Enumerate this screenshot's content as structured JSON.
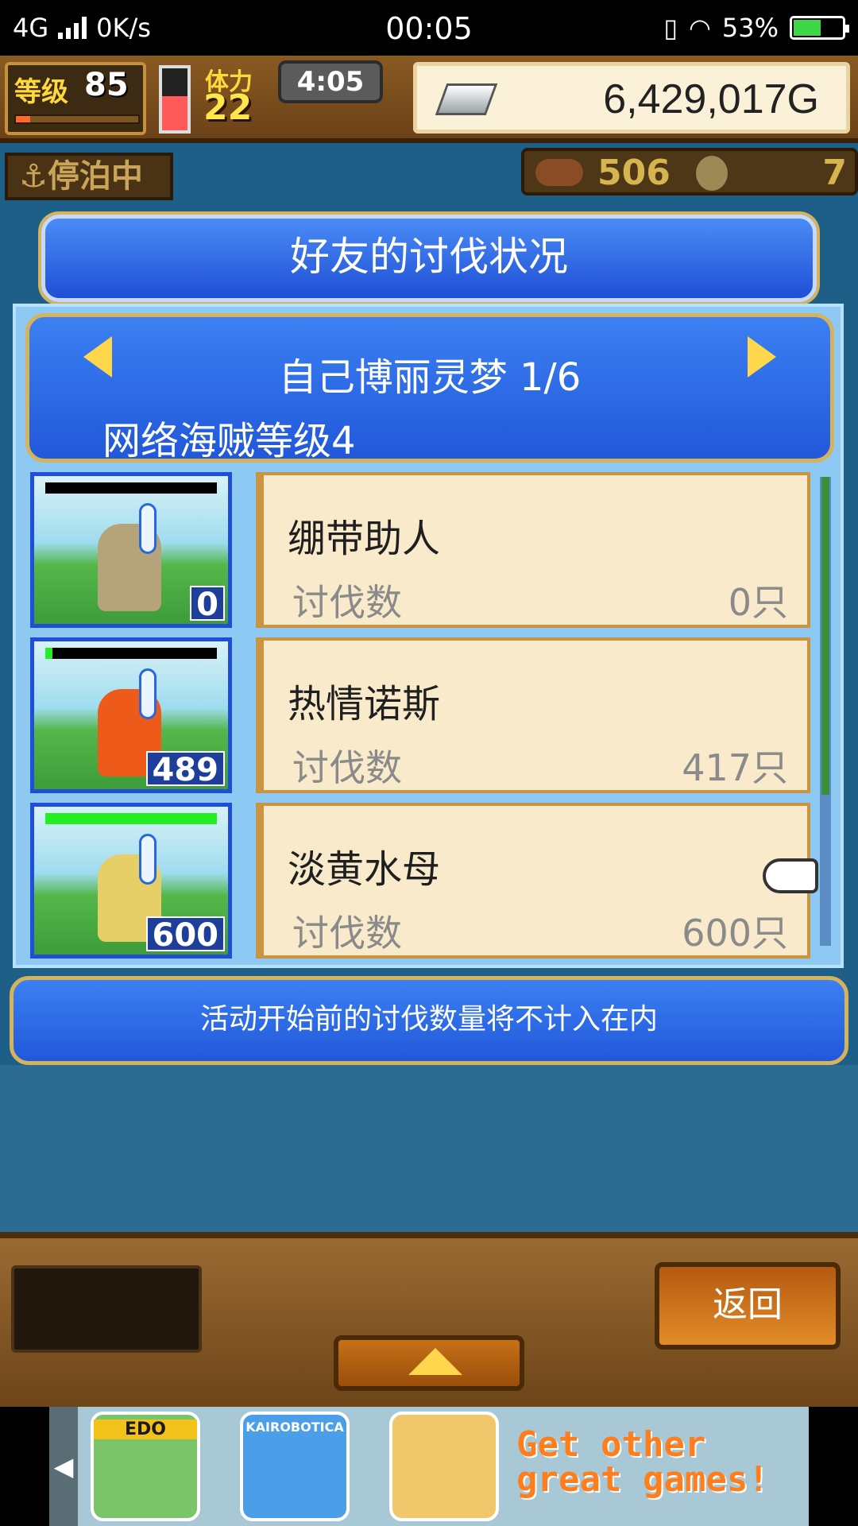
{
  "status_bar": {
    "network": "4G",
    "speed": "0K/s",
    "time": "00:05",
    "battery": "53%",
    "battery_level": 0.53
  },
  "hud": {
    "level_label": "等级",
    "level_value": "85",
    "exp_fraction": 0.12,
    "stamina_label": "体力",
    "stamina_value": "22",
    "stamina_fraction": 0.55,
    "timer": "4:05",
    "money": "6,429,017G",
    "dock_status": "停泊中",
    "fish_count": "506",
    "medal_count": "7"
  },
  "panel": {
    "title": "好友的讨伐状况",
    "friend_name": "自己博丽灵梦 1/6",
    "pirate_level": "网络海贼等级4",
    "notice": "活动开始前的讨伐数量将不计入在内",
    "monsters": [
      {
        "name": "绷带助人",
        "kill_label": "讨伐数",
        "kill_value": "0只",
        "badge": "0",
        "hp_fraction": 0.0,
        "color": "#b5a37a"
      },
      {
        "name": "热情诺斯",
        "kill_label": "讨伐数",
        "kill_value": "417只",
        "badge": "489",
        "hp_fraction": 0.04,
        "color": "#ee5a1a"
      },
      {
        "name": "淡黄水母",
        "kill_label": "讨伐数",
        "kill_value": "600只",
        "badge": "600",
        "hp_fraction": 1.0,
        "color": "#e6cf67"
      }
    ]
  },
  "bottom": {
    "back_label": "返回"
  },
  "ad_banner": {
    "games": [
      "EDO",
      "KAIROBOTICA"
    ],
    "cta": "Get other great games!"
  },
  "icons": {
    "prev": "arrow-left-icon",
    "next": "arrow-right-icon",
    "up": "arrow-up-icon",
    "pointer": "hand-pointer-icon"
  }
}
